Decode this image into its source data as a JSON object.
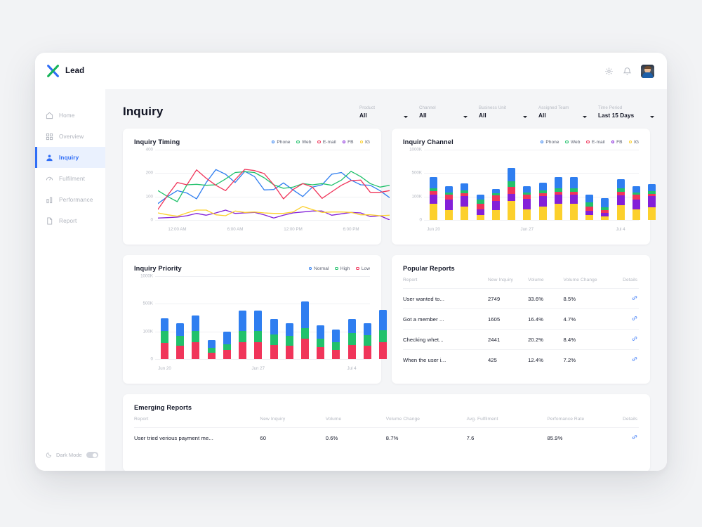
{
  "brand": {
    "name": "Lead"
  },
  "sidebar": {
    "items": [
      {
        "label": "Home",
        "icon": "home-icon",
        "active": false
      },
      {
        "label": "Overview",
        "icon": "grid-icon",
        "active": false
      },
      {
        "label": "Inquiry",
        "icon": "user-icon",
        "active": true
      },
      {
        "label": "Fulfilment",
        "icon": "speedometer-icon",
        "active": false
      },
      {
        "label": "Performance",
        "icon": "bar-chart-icon",
        "active": false
      },
      {
        "label": "Report",
        "icon": "document-icon",
        "active": false
      }
    ],
    "dark_mode": {
      "label": "Dark Mode",
      "icon": "moon-icon",
      "enabled": false
    }
  },
  "topbar": {
    "settings_icon": "gear-icon",
    "notifications_icon": "bell-icon",
    "avatar": "user-avatar"
  },
  "header": {
    "title": "Inquiry",
    "filters": [
      {
        "label": "Product",
        "value": "All"
      },
      {
        "label": "Channel",
        "value": "All"
      },
      {
        "label": "Business Unit",
        "value": "All"
      },
      {
        "label": "Assigned Team",
        "value": "All"
      },
      {
        "label": "Time Period",
        "value": "Last 15 Days"
      }
    ]
  },
  "colors": {
    "phone": "#2f7ef0",
    "web": "#21c16b",
    "email": "#f0355a",
    "fb": "#8320d8",
    "ig": "#fcd02c",
    "normal": "#2f7ef0",
    "high": "#21c16b",
    "low": "#f0355a",
    "accent": "#2f6df6"
  },
  "chart_data": [
    {
      "type": "line",
      "title": "Inquiry Timing",
      "xlabel": "",
      "ylabel": "",
      "ylim": [
        0,
        400
      ],
      "ytick_labels": [
        "400",
        "200",
        "100",
        "0"
      ],
      "ytick_values": [
        400,
        200,
        100,
        0
      ],
      "xtick_labels": [
        "12:00 AM",
        "6:00 AM",
        "12:00 PM",
        "6:00 PM"
      ],
      "xtick_positions": [
        2,
        8,
        14,
        20
      ],
      "grid": true,
      "legend": [
        {
          "name": "Phone",
          "color": "#2f7ef0"
        },
        {
          "name": "Web",
          "color": "#21c16b"
        },
        {
          "name": "E-mail",
          "color": "#f0355a"
        },
        {
          "name": "FB",
          "color": "#8320d8"
        },
        {
          "name": "IG",
          "color": "#fcd02c"
        }
      ],
      "series": [
        {
          "name": "Phone",
          "color": "#2f7ef0",
          "values": [
            70,
            100,
            125,
            115,
            90,
            160,
            230,
            195,
            160,
            215,
            185,
            128,
            130,
            158,
            128,
            100,
            140,
            150,
            195,
            205,
            170,
            150,
            148,
            125,
            95
          ]
        },
        {
          "name": "Web",
          "color": "#21c16b",
          "values": [
            125,
            100,
            78,
            150,
            152,
            148,
            150,
            175,
            205,
            212,
            205,
            180,
            150,
            135,
            140,
            155,
            150,
            155,
            148,
            170,
            215,
            185,
            155,
            140,
            148
          ]
        },
        {
          "name": "E-mail",
          "color": "#f0355a",
          "values": [
            45,
            105,
            160,
            150,
            228,
            178,
            148,
            125,
            172,
            232,
            222,
            198,
            150,
            90,
            130,
            155,
            140,
            92,
            120,
            148,
            168,
            170,
            118,
            118,
            125
          ]
        },
        {
          "name": "FB",
          "color": "#8320d8",
          "values": [
            8,
            10,
            12,
            18,
            28,
            20,
            30,
            42,
            28,
            30,
            32,
            22,
            8,
            20,
            30,
            34,
            38,
            38,
            20,
            26,
            32,
            30,
            14,
            18,
            0
          ]
        },
        {
          "name": "IG",
          "color": "#fcd02c",
          "values": [
            30,
            22,
            16,
            30,
            42,
            42,
            22,
            18,
            38,
            32,
            34,
            30,
            28,
            28,
            34,
            58,
            44,
            32,
            34,
            34,
            32,
            22,
            22,
            18,
            20
          ]
        }
      ]
    },
    {
      "type": "bar",
      "stacked": true,
      "title": "Inquiry Channel",
      "ylim": [
        0,
        1000
      ],
      "ytick_labels": [
        "1000K",
        "500K",
        "100K",
        "0"
      ],
      "ytick_values": [
        1000,
        500,
        100,
        0
      ],
      "xtick_labels": [
        "Jun 20",
        "Jun 27",
        "Jul 4"
      ],
      "xtick_indices": [
        0,
        6,
        12
      ],
      "grid": true,
      "legend": [
        {
          "name": "Phone",
          "color": "#2f7ef0"
        },
        {
          "name": "Web",
          "color": "#21c16b"
        },
        {
          "name": "E-mail",
          "color": "#f0355a"
        },
        {
          "name": "FB",
          "color": "#8320d8"
        },
        {
          "name": "IG",
          "color": "#fcd02c"
        }
      ],
      "categories": [
        "Jun 20",
        "Jun 21",
        "Jun 22",
        "Jun 23",
        "Jun 24",
        "Jun 25",
        "Jun 26",
        "Jun 27",
        "Jun 28",
        "Jun 29",
        "Jun 30",
        "Jul 1",
        "Jul 2",
        "Jul 3",
        "Jul 4"
      ],
      "series": [
        {
          "name": "IG",
          "color": "#fcd02c",
          "values": [
            68,
            42,
            58,
            22,
            42,
            80,
            45,
            58,
            68,
            68,
            22,
            16,
            62,
            45,
            55
          ]
        },
        {
          "name": "FB",
          "color": "#8320d8",
          "values": [
            62,
            45,
            55,
            24,
            40,
            70,
            45,
            55,
            60,
            60,
            16,
            14,
            58,
            42,
            48
          ]
        },
        {
          "name": "E-mail",
          "color": "#f0355a",
          "values": [
            58,
            40,
            48,
            22,
            35,
            110,
            38,
            48,
            56,
            55,
            18,
            12,
            62,
            45,
            45
          ]
        },
        {
          "name": "Web",
          "color": "#21c16b",
          "values": [
            58,
            42,
            48,
            20,
            35,
            95,
            38,
            45,
            58,
            55,
            18,
            12,
            55,
            40,
            45
          ]
        },
        {
          "name": "Phone",
          "color": "#2f7ef0",
          "values": [
            186,
            110,
            115,
            45,
            80,
            250,
            110,
            130,
            190,
            190,
            55,
            38,
            155,
            105,
            120
          ]
        }
      ]
    },
    {
      "type": "bar",
      "stacked": true,
      "title": "Inquiry Priority",
      "ylim": [
        0,
        1000
      ],
      "ytick_labels": [
        "1000K",
        "500K",
        "100K",
        "0"
      ],
      "ytick_values": [
        1000,
        500,
        100,
        0
      ],
      "xtick_labels": [
        "Jun 20",
        "Jun 27",
        "Jul 4"
      ],
      "xtick_indices": [
        0,
        6,
        12
      ],
      "grid": true,
      "legend": [
        {
          "name": "Normal",
          "color": "#2f7ef0"
        },
        {
          "name": "High",
          "color": "#21c16b"
        },
        {
          "name": "Low",
          "color": "#f0355a"
        }
      ],
      "categories": [
        "Jun 20",
        "Jun 21",
        "Jun 22",
        "Jun 23",
        "Jun 24",
        "Jun 25",
        "Jun 26",
        "Jun 27",
        "Jun 28",
        "Jun 29",
        "Jun 30",
        "Jul 1",
        "Jul 2",
        "Jul 3"
      ],
      "series": [
        {
          "name": "Low",
          "color": "#f0355a",
          "values": [
            58,
            48,
            62,
            22,
            32,
            62,
            62,
            50,
            48,
            75,
            42,
            32,
            52,
            48,
            62
          ]
        },
        {
          "name": "High",
          "color": "#21c16b",
          "values": [
            45,
            35,
            45,
            18,
            22,
            48,
            48,
            38,
            35,
            72,
            32,
            28,
            42,
            38,
            52
          ]
        },
        {
          "name": "Normal",
          "color": "#2f7ef0",
          "values": [
            185,
            135,
            225,
            28,
            48,
            295,
            295,
            190,
            135,
            395,
            112,
            68,
            185,
            135,
            295
          ]
        }
      ]
    }
  ],
  "popular_reports": {
    "title": "Popular Reports",
    "columns": [
      "Report",
      "New Inquiry",
      "Volume",
      "Volume Change",
      "Details"
    ],
    "rows": [
      {
        "report": "User wanted to...",
        "new_inquiry": "2749",
        "volume": "33.6%",
        "volume_change": "8.5%",
        "details": "link-icon"
      },
      {
        "report": "Got a member ...",
        "new_inquiry": "1605",
        "volume": "16.4%",
        "volume_change": "4.7%",
        "details": "link-icon"
      },
      {
        "report": "Checking whet...",
        "new_inquiry": "2441",
        "volume": "20.2%",
        "volume_change": "8.4%",
        "details": "link-icon"
      },
      {
        "report": "When the user i...",
        "new_inquiry": "425",
        "volume": "12.4%",
        "volume_change": "7.2%",
        "details": "link-icon"
      }
    ]
  },
  "emerging_reports": {
    "title": "Emerging Reports",
    "columns": [
      "Report",
      "New Inquiry",
      "Volume",
      "Volume Change",
      "Avg. Fulfilment",
      "Perfomance Rate",
      "Details"
    ],
    "rows": [
      {
        "report": "User tried verious payment me...",
        "new_inquiry": "60",
        "volume": "0.6%",
        "volume_change": "8.7%",
        "avg_fulfilment": "7.6",
        "performance_rate": "85.9%",
        "details": "link-icon"
      }
    ]
  }
}
